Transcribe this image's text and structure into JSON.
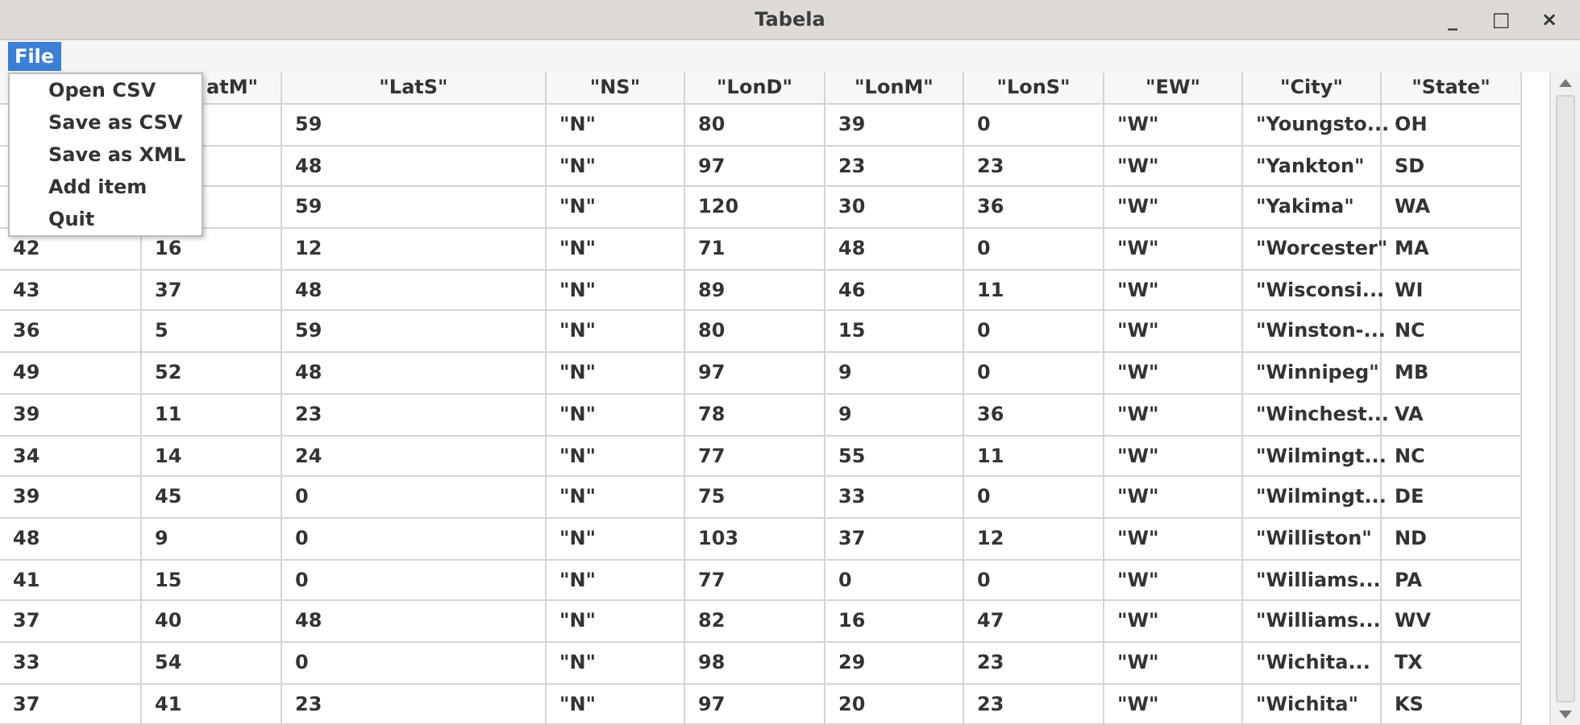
{
  "window": {
    "title": "Tabela",
    "controls": [
      "_",
      "□",
      "×"
    ]
  },
  "menubar": [
    {
      "label": "File",
      "selected": true
    }
  ],
  "menu": {
    "items": [
      "Open CSV",
      "Save as CSV",
      "Save as XML",
      "Add item",
      "Quit"
    ]
  },
  "table": {
    "columns": [
      null,
      "atM\"",
      "\"LatS\"",
      "\"NS\"",
      "\"LonD\"",
      "\"LonM\"",
      "\"LonS\"",
      "\"EW\"",
      "\"City\"",
      "\"State\""
    ],
    "rows": [
      [
        null,
        null,
        "59",
        "\"N\"",
        "80",
        "39",
        "0",
        "\"W\"",
        "\"Youngsto...",
        "OH"
      ],
      [
        null,
        null,
        "48",
        "\"N\"",
        "97",
        "23",
        "23",
        "\"W\"",
        "\"Yankton\"",
        "SD"
      ],
      [
        null,
        null,
        "59",
        "\"N\"",
        "120",
        "30",
        "36",
        "\"W\"",
        "\"Yakima\"",
        "WA"
      ],
      [
        "42",
        "16",
        "12",
        "\"N\"",
        "71",
        "48",
        "0",
        "\"W\"",
        "\"Worcester\"",
        "MA"
      ],
      [
        "43",
        "37",
        "48",
        "\"N\"",
        "89",
        "46",
        "11",
        "\"W\"",
        "\"Wisconsi...",
        "WI"
      ],
      [
        "36",
        "5",
        "59",
        "\"N\"",
        "80",
        "15",
        "0",
        "\"W\"",
        "\"Winston-...",
        "NC"
      ],
      [
        "49",
        "52",
        "48",
        "\"N\"",
        "97",
        "9",
        "0",
        "\"W\"",
        "\"Winnipeg\"",
        "MB"
      ],
      [
        "39",
        "11",
        "23",
        "\"N\"",
        "78",
        "9",
        "36",
        "\"W\"",
        "\"Winchest...",
        "VA"
      ],
      [
        "34",
        "14",
        "24",
        "\"N\"",
        "77",
        "55",
        "11",
        "\"W\"",
        "\"Wilmingt...",
        "NC"
      ],
      [
        "39",
        "45",
        "0",
        "\"N\"",
        "75",
        "33",
        "0",
        "\"W\"",
        "\"Wilmingt...",
        "DE"
      ],
      [
        "48",
        "9",
        "0",
        "\"N\"",
        "103",
        "37",
        "12",
        "\"W\"",
        "\"Williston\"",
        "ND"
      ],
      [
        "41",
        "15",
        "0",
        "\"N\"",
        "77",
        "0",
        "0",
        "\"W\"",
        "\"Williams...",
        "PA"
      ],
      [
        "37",
        "40",
        "48",
        "\"N\"",
        "82",
        "16",
        "47",
        "\"W\"",
        "\"Williams...",
        "WV"
      ],
      [
        "33",
        "54",
        "0",
        "\"N\"",
        "98",
        "29",
        "23",
        "\"W\"",
        "\"Wichita...",
        "TX"
      ],
      [
        "37",
        "41",
        "23",
        "\"N\"",
        "97",
        "20",
        "23",
        "\"W\"",
        "\"Wichita\"",
        "KS"
      ]
    ]
  }
}
